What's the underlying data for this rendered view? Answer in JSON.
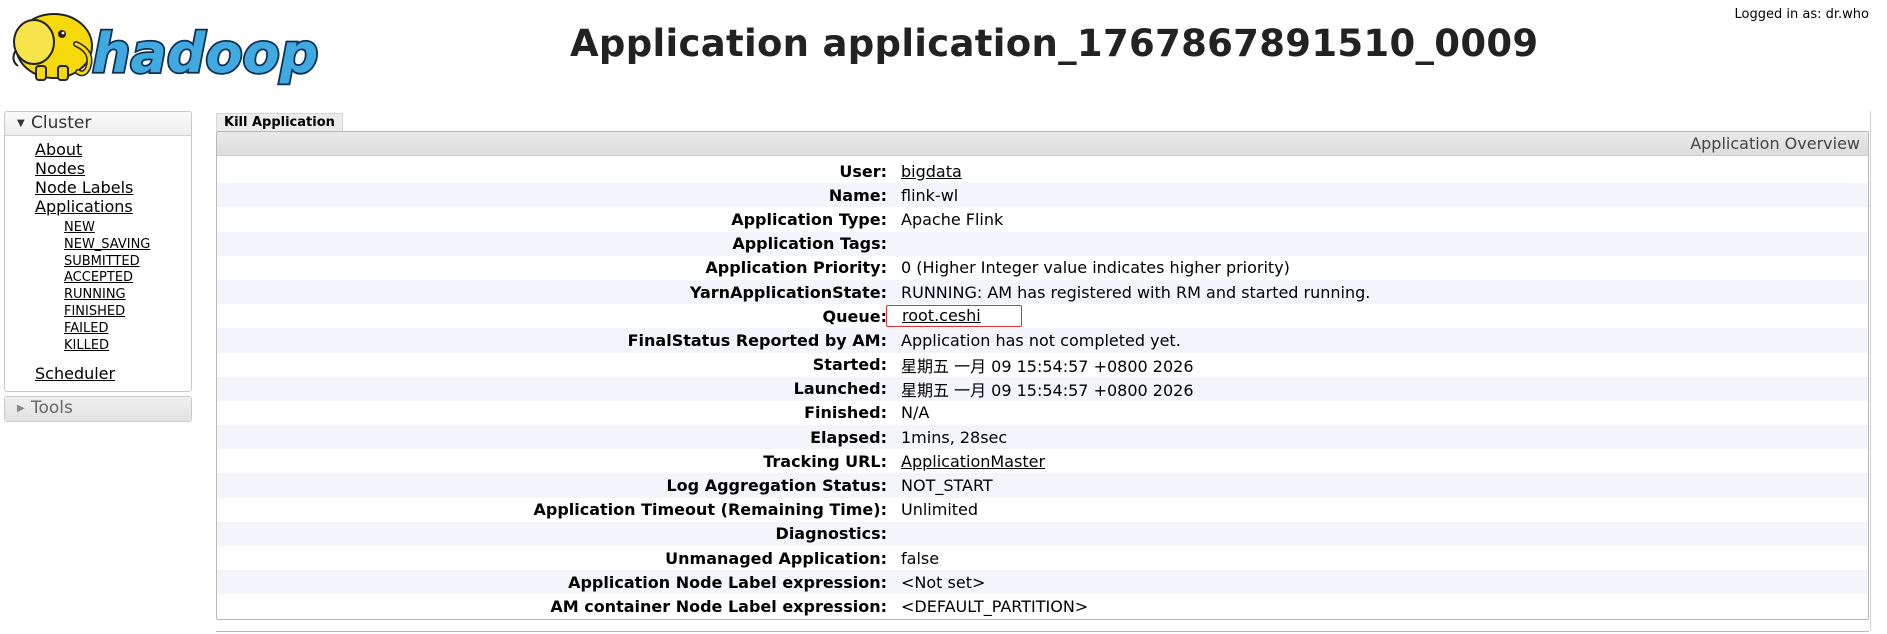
{
  "header": {
    "title": "Application application_1767867891510_0009",
    "logged_in": "Logged in as: dr.who",
    "logo_text": "hadoop"
  },
  "sidebar": {
    "cluster": {
      "label": "Cluster",
      "items": [
        "About",
        "Nodes",
        "Node Labels",
        "Applications"
      ],
      "app_states": [
        "NEW",
        "NEW_SAVING",
        "SUBMITTED",
        "ACCEPTED",
        "RUNNING",
        "FINISHED",
        "FAILED",
        "KILLED"
      ],
      "scheduler": "Scheduler"
    },
    "tools": {
      "label": "Tools"
    }
  },
  "main": {
    "kill_button": "Kill Application",
    "overview_title": "Application Overview",
    "rows": [
      {
        "k": "User:",
        "v": "bigdata",
        "link": true
      },
      {
        "k": "Name:",
        "v": "flink-wl"
      },
      {
        "k": "Application Type:",
        "v": "Apache Flink"
      },
      {
        "k": "Application Tags:",
        "v": ""
      },
      {
        "k": "Application Priority:",
        "v": "0 (Higher Integer value indicates higher priority)"
      },
      {
        "k": "YarnApplicationState:",
        "v": "RUNNING: AM has registered with RM and started running."
      },
      {
        "k": "Queue:",
        "v": "root.ceshi",
        "link": true,
        "highlight": true
      },
      {
        "k": "FinalStatus Reported by AM:",
        "v": "Application has not completed yet."
      },
      {
        "k": "Started:",
        "v": "星期五 一月 09 15:54:57 +0800 2026"
      },
      {
        "k": "Launched:",
        "v": "星期五 一月 09 15:54:57 +0800 2026"
      },
      {
        "k": "Finished:",
        "v": "N/A"
      },
      {
        "k": "Elapsed:",
        "v": "1mins, 28sec"
      },
      {
        "k": "Tracking URL:",
        "v": "ApplicationMaster",
        "link": true
      },
      {
        "k": "Log Aggregation Status:",
        "v": "NOT_START"
      },
      {
        "k": "Application Timeout (Remaining Time):",
        "v": "Unlimited"
      },
      {
        "k": "Diagnostics:",
        "v": ""
      },
      {
        "k": "Unmanaged Application:",
        "v": "false"
      },
      {
        "k": "Application Node Label expression:",
        "v": "<Not set>"
      },
      {
        "k": "AM container Node Label expression:",
        "v": "<DEFAULT_PARTITION>"
      }
    ]
  },
  "colors": {
    "highlight_border": "#e03030",
    "row_stripe": "#f4f4fb",
    "logo_blue": "#3fa9e0",
    "logo_yellow": "#f5d90a"
  }
}
